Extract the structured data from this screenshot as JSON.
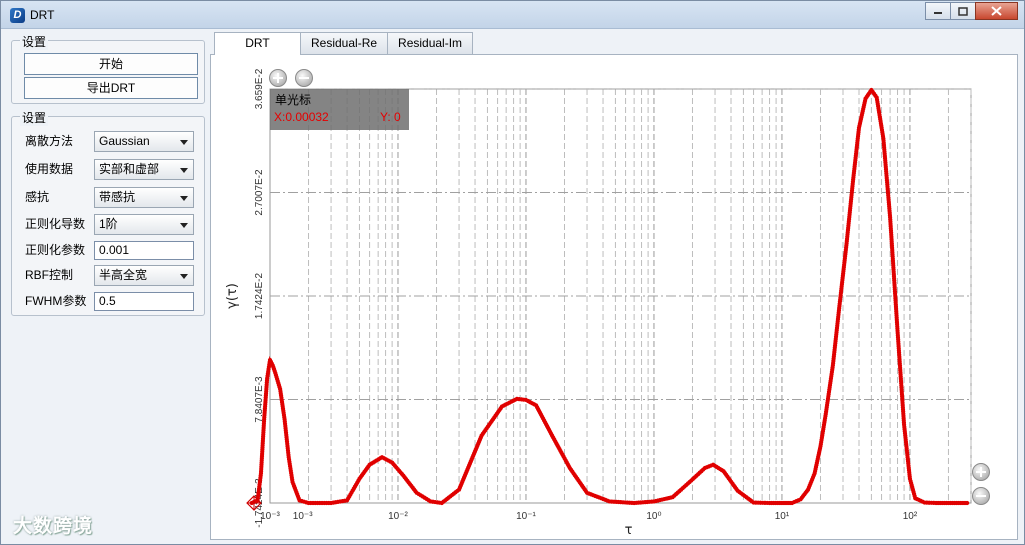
{
  "window": {
    "title": "DRT",
    "icon": "app-logo-icon"
  },
  "left": {
    "group1_title": "设置",
    "start_button": "开始",
    "export_button": "导出DRT",
    "group2_title": "设置",
    "fields": {
      "discretization_label": "离散方法",
      "discretization_value": "Gaussian",
      "data_label": "使用数据",
      "data_value": "实部和虚部",
      "inductance_label": "感抗",
      "inductance_value": "带感抗",
      "reg_derivative_label": "正则化导数",
      "reg_derivative_value": "1阶",
      "reg_param_label": "正则化参数",
      "reg_param_value": "0.001",
      "rbf_label": "RBF控制",
      "rbf_value": "半高全宽",
      "fwhm_label": "FWHM参数",
      "fwhm_value": "0.5"
    }
  },
  "tabs": {
    "drt": "DRT",
    "residual_re": "Residual-Re",
    "residual_im": "Residual-Im"
  },
  "cursor": {
    "title": "单光标",
    "x": "X:0.00032",
    "y": "Y: 0"
  },
  "watermark": "大数跨境",
  "chart_data": {
    "type": "scatter",
    "title": "",
    "xlabel": "τ",
    "ylabel": "γ(τ)",
    "x_scale": "log",
    "xlim": [
      0.001,
      300
    ],
    "ylim": [
      -0.0017424,
      0.03659
    ],
    "x_tick_labels": [
      "10⁻³",
      "10⁻³",
      "10⁻²",
      "10⁻¹",
      "10⁰",
      "10¹",
      "10²"
    ],
    "y_tick_labels": [
      "-1.7424E-3",
      "7.8407E-3",
      "1.7424E-2",
      "2.7007E-2",
      "3.659E-2"
    ],
    "grid": true,
    "color": "#e00000",
    "series": [
      {
        "x": [
          0.00072,
          0.0008,
          0.00085,
          0.0009,
          0.00095,
          0.001,
          0.00105,
          0.0011,
          0.0012,
          0.0013,
          0.0014,
          0.0015,
          0.0017,
          0.002,
          0.003,
          0.004,
          0.005,
          0.006,
          0.0075,
          0.009,
          0.011,
          0.014,
          0.018,
          0.022,
          0.03,
          0.045,
          0.065,
          0.085,
          0.1,
          0.12,
          0.16,
          0.22,
          0.3,
          0.45,
          0.7,
          1.0,
          1.4,
          1.9,
          2.5,
          2.9,
          3.5,
          4.5,
          6.0,
          8.0,
          10.0,
          12.0,
          14.0,
          16.0,
          18.0,
          20.0,
          22.0,
          25.0,
          28.0,
          32.0,
          36.0,
          40.0,
          45.0,
          50.0,
          55.0,
          62.0,
          70.0,
          80.0,
          90.0,
          100.0,
          110.0,
          130.0,
          160.0,
          200.0,
          250.0,
          290.0
        ],
        "y": [
          -0.0017424,
          -0.0015,
          0.001,
          0.006,
          0.0098,
          0.0115,
          0.011,
          0.0103,
          0.0088,
          0.006,
          0.0025,
          0.0002,
          -0.0015,
          -0.0017424,
          -0.0017424,
          -0.0015,
          0.0005,
          0.0018,
          0.0025,
          0.002,
          0.0008,
          -0.0008,
          -0.0016,
          -0.0017424,
          -0.0005,
          0.0045,
          0.0072,
          0.0079,
          0.0078,
          0.0073,
          0.0045,
          0.0015,
          -0.0008,
          -0.0016,
          -0.0017424,
          -0.0016,
          -0.0012,
          0.0002,
          0.0015,
          0.0018,
          0.0012,
          -0.0006,
          -0.0017,
          -0.0017424,
          -0.0017424,
          -0.0017424,
          -0.0014,
          -0.0005,
          0.001,
          0.0035,
          0.0065,
          0.011,
          0.0163,
          0.0223,
          0.0282,
          0.033,
          0.0357,
          0.0365,
          0.0358,
          0.032,
          0.0247,
          0.0142,
          0.0055,
          0.0005,
          -0.0013,
          -0.0017,
          -0.0017424,
          -0.0017424,
          -0.0017424,
          -0.0017424
        ]
      }
    ]
  }
}
